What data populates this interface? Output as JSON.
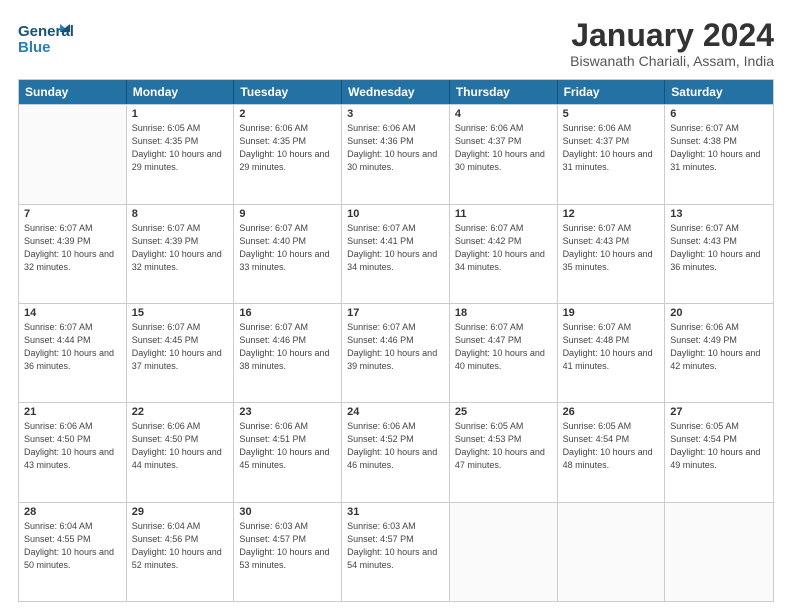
{
  "header": {
    "logo_line1": "General",
    "logo_line2": "Blue",
    "title": "January 2024",
    "subtitle": "Biswanath Chariali, Assam, India"
  },
  "days_of_week": [
    "Sunday",
    "Monday",
    "Tuesday",
    "Wednesday",
    "Thursday",
    "Friday",
    "Saturday"
  ],
  "weeks": [
    [
      {
        "day": "",
        "sunrise": "",
        "sunset": "",
        "daylight": ""
      },
      {
        "day": "1",
        "sunrise": "Sunrise: 6:05 AM",
        "sunset": "Sunset: 4:35 PM",
        "daylight": "Daylight: 10 hours and 29 minutes."
      },
      {
        "day": "2",
        "sunrise": "Sunrise: 6:06 AM",
        "sunset": "Sunset: 4:35 PM",
        "daylight": "Daylight: 10 hours and 29 minutes."
      },
      {
        "day": "3",
        "sunrise": "Sunrise: 6:06 AM",
        "sunset": "Sunset: 4:36 PM",
        "daylight": "Daylight: 10 hours and 30 minutes."
      },
      {
        "day": "4",
        "sunrise": "Sunrise: 6:06 AM",
        "sunset": "Sunset: 4:37 PM",
        "daylight": "Daylight: 10 hours and 30 minutes."
      },
      {
        "day": "5",
        "sunrise": "Sunrise: 6:06 AM",
        "sunset": "Sunset: 4:37 PM",
        "daylight": "Daylight: 10 hours and 31 minutes."
      },
      {
        "day": "6",
        "sunrise": "Sunrise: 6:07 AM",
        "sunset": "Sunset: 4:38 PM",
        "daylight": "Daylight: 10 hours and 31 minutes."
      }
    ],
    [
      {
        "day": "7",
        "sunrise": "Sunrise: 6:07 AM",
        "sunset": "Sunset: 4:39 PM",
        "daylight": "Daylight: 10 hours and 32 minutes."
      },
      {
        "day": "8",
        "sunrise": "Sunrise: 6:07 AM",
        "sunset": "Sunset: 4:39 PM",
        "daylight": "Daylight: 10 hours and 32 minutes."
      },
      {
        "day": "9",
        "sunrise": "Sunrise: 6:07 AM",
        "sunset": "Sunset: 4:40 PM",
        "daylight": "Daylight: 10 hours and 33 minutes."
      },
      {
        "day": "10",
        "sunrise": "Sunrise: 6:07 AM",
        "sunset": "Sunset: 4:41 PM",
        "daylight": "Daylight: 10 hours and 34 minutes."
      },
      {
        "day": "11",
        "sunrise": "Sunrise: 6:07 AM",
        "sunset": "Sunset: 4:42 PM",
        "daylight": "Daylight: 10 hours and 34 minutes."
      },
      {
        "day": "12",
        "sunrise": "Sunrise: 6:07 AM",
        "sunset": "Sunset: 4:43 PM",
        "daylight": "Daylight: 10 hours and 35 minutes."
      },
      {
        "day": "13",
        "sunrise": "Sunrise: 6:07 AM",
        "sunset": "Sunset: 4:43 PM",
        "daylight": "Daylight: 10 hours and 36 minutes."
      }
    ],
    [
      {
        "day": "14",
        "sunrise": "Sunrise: 6:07 AM",
        "sunset": "Sunset: 4:44 PM",
        "daylight": "Daylight: 10 hours and 36 minutes."
      },
      {
        "day": "15",
        "sunrise": "Sunrise: 6:07 AM",
        "sunset": "Sunset: 4:45 PM",
        "daylight": "Daylight: 10 hours and 37 minutes."
      },
      {
        "day": "16",
        "sunrise": "Sunrise: 6:07 AM",
        "sunset": "Sunset: 4:46 PM",
        "daylight": "Daylight: 10 hours and 38 minutes."
      },
      {
        "day": "17",
        "sunrise": "Sunrise: 6:07 AM",
        "sunset": "Sunset: 4:46 PM",
        "daylight": "Daylight: 10 hours and 39 minutes."
      },
      {
        "day": "18",
        "sunrise": "Sunrise: 6:07 AM",
        "sunset": "Sunset: 4:47 PM",
        "daylight": "Daylight: 10 hours and 40 minutes."
      },
      {
        "day": "19",
        "sunrise": "Sunrise: 6:07 AM",
        "sunset": "Sunset: 4:48 PM",
        "daylight": "Daylight: 10 hours and 41 minutes."
      },
      {
        "day": "20",
        "sunrise": "Sunrise: 6:06 AM",
        "sunset": "Sunset: 4:49 PM",
        "daylight": "Daylight: 10 hours and 42 minutes."
      }
    ],
    [
      {
        "day": "21",
        "sunrise": "Sunrise: 6:06 AM",
        "sunset": "Sunset: 4:50 PM",
        "daylight": "Daylight: 10 hours and 43 minutes."
      },
      {
        "day": "22",
        "sunrise": "Sunrise: 6:06 AM",
        "sunset": "Sunset: 4:50 PM",
        "daylight": "Daylight: 10 hours and 44 minutes."
      },
      {
        "day": "23",
        "sunrise": "Sunrise: 6:06 AM",
        "sunset": "Sunset: 4:51 PM",
        "daylight": "Daylight: 10 hours and 45 minutes."
      },
      {
        "day": "24",
        "sunrise": "Sunrise: 6:06 AM",
        "sunset": "Sunset: 4:52 PM",
        "daylight": "Daylight: 10 hours and 46 minutes."
      },
      {
        "day": "25",
        "sunrise": "Sunrise: 6:05 AM",
        "sunset": "Sunset: 4:53 PM",
        "daylight": "Daylight: 10 hours and 47 minutes."
      },
      {
        "day": "26",
        "sunrise": "Sunrise: 6:05 AM",
        "sunset": "Sunset: 4:54 PM",
        "daylight": "Daylight: 10 hours and 48 minutes."
      },
      {
        "day": "27",
        "sunrise": "Sunrise: 6:05 AM",
        "sunset": "Sunset: 4:54 PM",
        "daylight": "Daylight: 10 hours and 49 minutes."
      }
    ],
    [
      {
        "day": "28",
        "sunrise": "Sunrise: 6:04 AM",
        "sunset": "Sunset: 4:55 PM",
        "daylight": "Daylight: 10 hours and 50 minutes."
      },
      {
        "day": "29",
        "sunrise": "Sunrise: 6:04 AM",
        "sunset": "Sunset: 4:56 PM",
        "daylight": "Daylight: 10 hours and 52 minutes."
      },
      {
        "day": "30",
        "sunrise": "Sunrise: 6:03 AM",
        "sunset": "Sunset: 4:57 PM",
        "daylight": "Daylight: 10 hours and 53 minutes."
      },
      {
        "day": "31",
        "sunrise": "Sunrise: 6:03 AM",
        "sunset": "Sunset: 4:57 PM",
        "daylight": "Daylight: 10 hours and 54 minutes."
      },
      {
        "day": "",
        "sunrise": "",
        "sunset": "",
        "daylight": ""
      },
      {
        "day": "",
        "sunrise": "",
        "sunset": "",
        "daylight": ""
      },
      {
        "day": "",
        "sunrise": "",
        "sunset": "",
        "daylight": ""
      }
    ]
  ]
}
